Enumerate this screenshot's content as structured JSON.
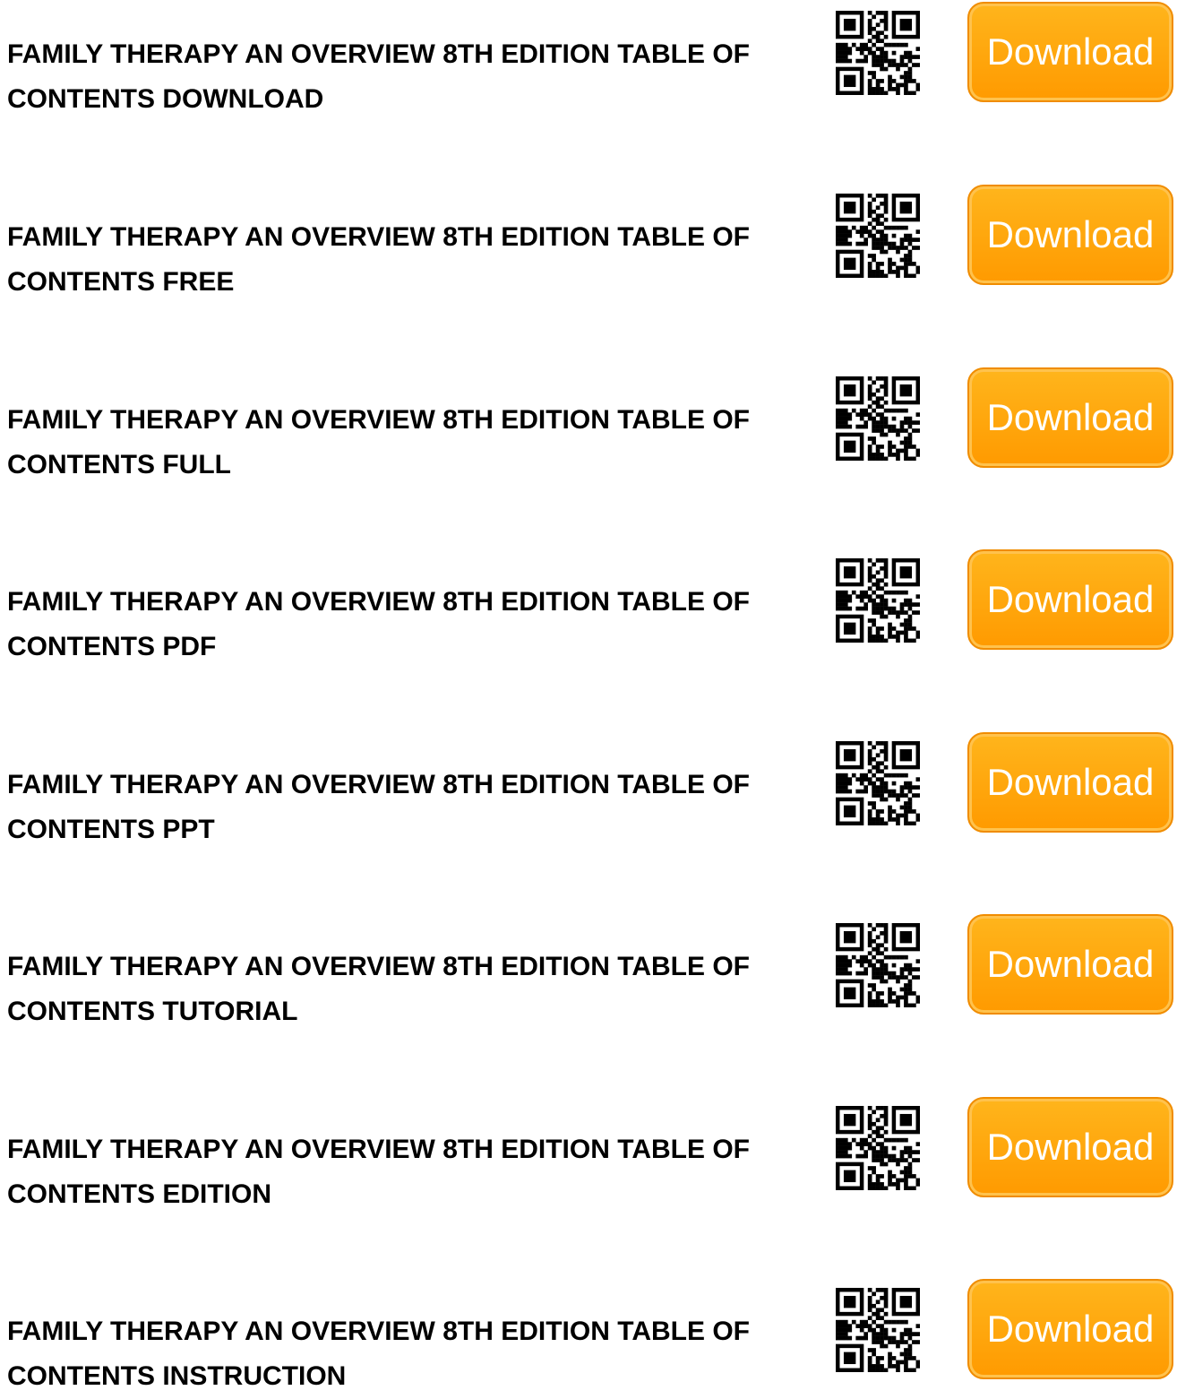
{
  "items": [
    {
      "title": "FAMILY THERAPY AN OVERVIEW 8TH EDITION TABLE OF CONTENTS DOWNLOAD",
      "button_label": "Download"
    },
    {
      "title": "FAMILY THERAPY AN OVERVIEW 8TH EDITION TABLE OF CONTENTS FREE",
      "button_label": "Download"
    },
    {
      "title": "FAMILY THERAPY AN OVERVIEW 8TH EDITION TABLE OF CONTENTS FULL",
      "button_label": "Download"
    },
    {
      "title": "FAMILY THERAPY AN OVERVIEW 8TH EDITION TABLE OF CONTENTS PDF",
      "button_label": "Download"
    },
    {
      "title": "FAMILY THERAPY AN OVERVIEW 8TH EDITION TABLE OF CONTENTS PPT",
      "button_label": "Download"
    },
    {
      "title": "FAMILY THERAPY AN OVERVIEW 8TH EDITION TABLE OF CONTENTS TUTORIAL",
      "button_label": "Download"
    },
    {
      "title": "FAMILY THERAPY AN OVERVIEW 8TH EDITION TABLE OF CONTENTS EDITION",
      "button_label": "Download"
    },
    {
      "title": "FAMILY THERAPY AN OVERVIEW 8TH EDITION TABLE OF CONTENTS INSTRUCTION",
      "button_label": "Download"
    }
  ],
  "colors": {
    "button_fill": "#ff9f00",
    "button_text": "#ffffff",
    "title_text": "#000000"
  },
  "icons": {
    "qr": "qr-code-icon"
  }
}
